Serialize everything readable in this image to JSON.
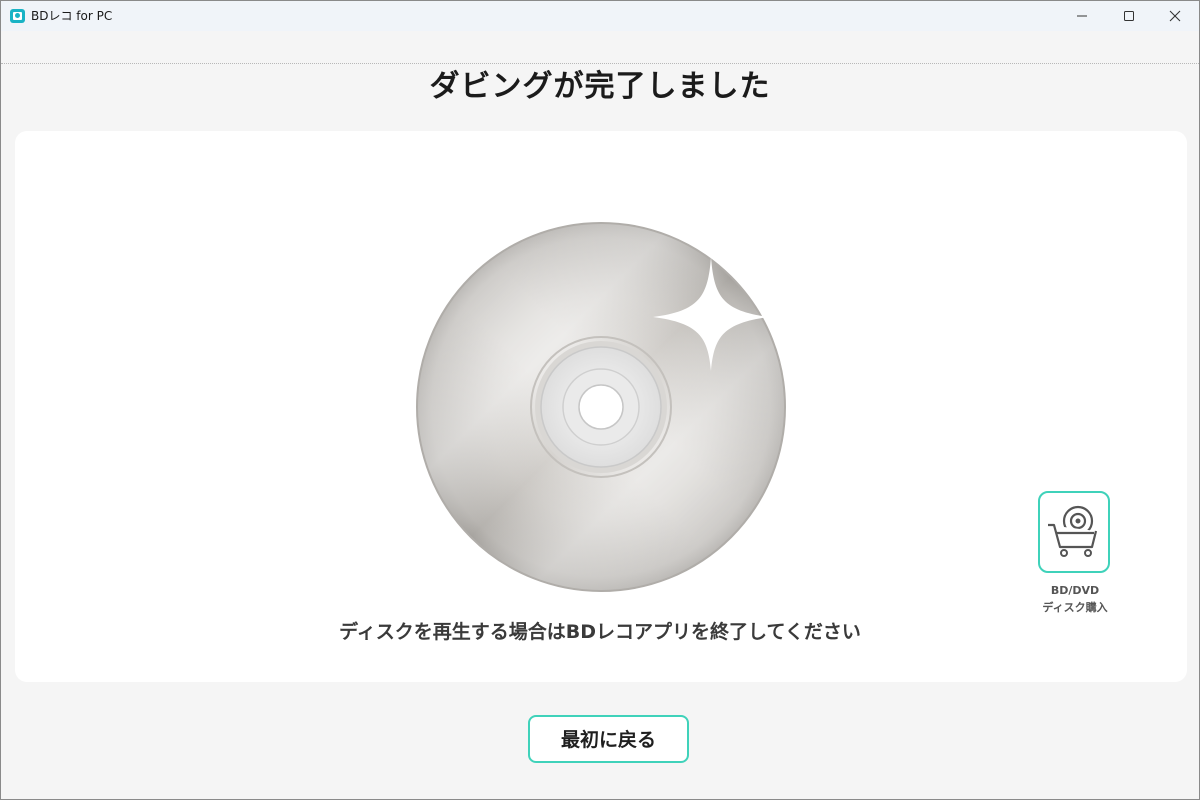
{
  "window": {
    "title": "BDレコ for PC",
    "controls": [
      "minimize-icon",
      "maximize-icon",
      "close-icon"
    ]
  },
  "main": {
    "heading": "ダビングが完了しました",
    "message": "ディスクを再生する場合はBDレコアプリを終了してください",
    "disc_icon": "disc-sparkle-icon"
  },
  "shop": {
    "icon": "disc-cart-icon",
    "label_line1": "BD/DVD",
    "label_line2": "ディスク購入"
  },
  "footer": {
    "back_button_label": "最初に戻る"
  },
  "colors": {
    "accent": "#3fd2ba",
    "app_icon": "#19b3c5",
    "background": "#f5f5f5",
    "card": "#ffffff"
  }
}
